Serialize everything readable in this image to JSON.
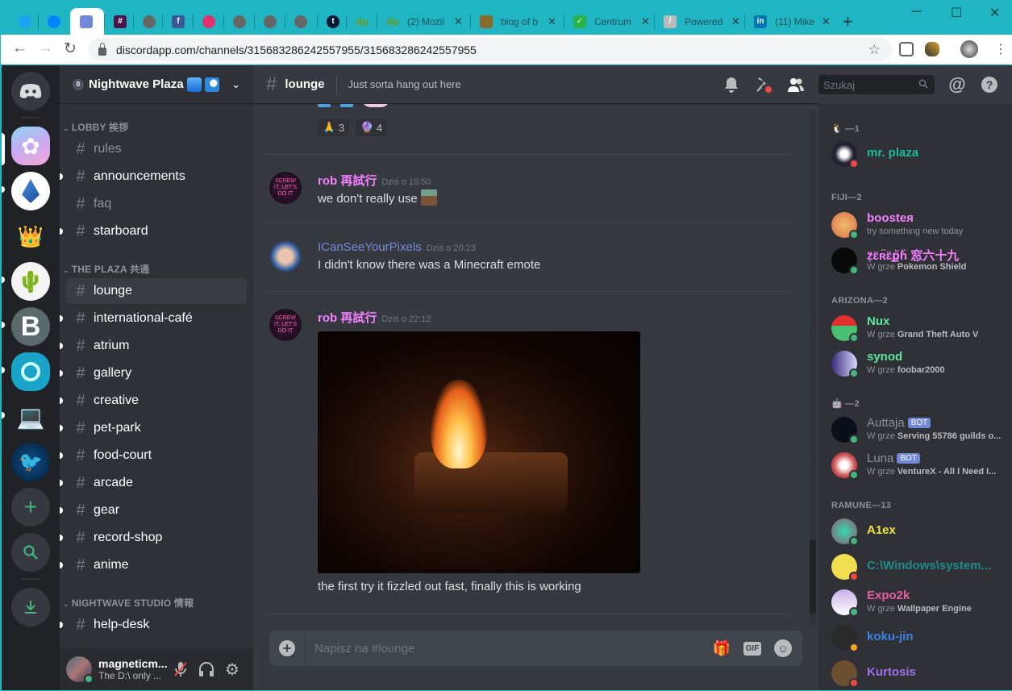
{
  "browser": {
    "tabs": [
      {
        "title": "",
        "favicon": "twitter-icon",
        "color": "#1da1f2"
      },
      {
        "title": "",
        "favicon": "messenger-icon",
        "color": "#0084ff"
      },
      {
        "title": "",
        "favicon": "discord-icon",
        "color": "#7289da",
        "active": true
      },
      {
        "title": "",
        "favicon": "slack-icon",
        "color": "#4a154b"
      },
      {
        "title": "",
        "favicon": "globe-icon",
        "color": "#666"
      },
      {
        "title": "",
        "favicon": "facebook-icon",
        "color": "#3b5998"
      },
      {
        "title": "",
        "favicon": "instagram-icon",
        "color": "#e1306c"
      },
      {
        "title": "",
        "favicon": "globe-icon",
        "color": "#666"
      },
      {
        "title": "",
        "favicon": "globe-icon",
        "color": "#666"
      },
      {
        "title": "",
        "favicon": "globe-icon",
        "color": "#666"
      },
      {
        "title": "",
        "favicon": "tumblr-icon",
        "color": "#001935"
      },
      {
        "title": "",
        "favicon": "dp-icon",
        "color": "#6a9a1f"
      },
      {
        "title": "(2) Mozil",
        "favicon": "dp-icon",
        "color": "#6a9a1f"
      },
      {
        "title": "blog of b",
        "favicon": "avatar-icon",
        "color": "#8a6a2a"
      },
      {
        "title": "Centrum",
        "favicon": "checkbox-icon",
        "color": "#2bb34a"
      },
      {
        "title": "Powered",
        "favicon": "feather-icon",
        "color": "#bbb"
      },
      {
        "title": "(11) Mike",
        "favicon": "linkedin-icon",
        "color": "#0077b5"
      }
    ],
    "url": "discordapp.com/channels/315683286242557955/315683286242557955"
  },
  "server": {
    "name": "Nightwave Plaza",
    "categories": [
      {
        "name": "LOBBY 挨拶"
      },
      {
        "name": "THE PLAZA 共通"
      },
      {
        "name": "NIGHTWAVE STUDIO 情報"
      }
    ],
    "channels": [
      {
        "name": "rules",
        "state": "read"
      },
      {
        "name": "announcements",
        "state": "unread"
      },
      {
        "name": "faq",
        "state": "read"
      },
      {
        "name": "starboard",
        "state": "unread"
      },
      {
        "name": "lounge",
        "state": "active"
      },
      {
        "name": "international-café",
        "state": "unread"
      },
      {
        "name": "atrium",
        "state": "unread"
      },
      {
        "name": "gallery",
        "state": "unread"
      },
      {
        "name": "creative",
        "state": "unread"
      },
      {
        "name": "pet-park",
        "state": "unread"
      },
      {
        "name": "food-court",
        "state": "unread"
      },
      {
        "name": "arcade",
        "state": "unread"
      },
      {
        "name": "gear",
        "state": "unread"
      },
      {
        "name": "record-shop",
        "state": "unread"
      },
      {
        "name": "anime",
        "state": "unread"
      },
      {
        "name": "help-desk",
        "state": "unread"
      }
    ]
  },
  "user": {
    "name": "magneticm...",
    "status": "The D:\\ only ..."
  },
  "chat": {
    "channel": "lounge",
    "topic": "Just sorta hang out here",
    "reactions": [
      {
        "emoji": "🙏",
        "count": "3"
      },
      {
        "emoji": "🔮",
        "count": "4"
      }
    ],
    "messages": [
      {
        "author": "rob 再試行",
        "color": "#f47fff",
        "time": "Dziś o 19:50",
        "text": "we don't really use"
      },
      {
        "author": "ICanSeeYourPixels",
        "color": "#7289da",
        "time": "Dziś o 20:23",
        "text": "I didn't know there was a Minecraft emote"
      },
      {
        "author": "rob 再試行",
        "color": "#f47fff",
        "time": "Dziś o 22:12",
        "text": "the first try it fizzled out fast, finally this is working"
      }
    ],
    "composer_placeholder": "Napisz na #lounge"
  },
  "header": {
    "search_placeholder": "Szukaj"
  },
  "members": {
    "groups": [
      {
        "label": "—1"
      },
      {
        "label": "FIJI—2"
      },
      {
        "label": "ARIZONA—2"
      },
      {
        "label": "—2"
      },
      {
        "label": "RAMUNE—13"
      }
    ],
    "list": [
      {
        "name": "mr. plaza",
        "color": "#1abc9c",
        "activity": "",
        "status": "dnd"
      },
      {
        "name": "boosteя",
        "color": "#f47fff",
        "activity": "try something new today",
        "status": "online"
      },
      {
        "name": "ẓ̈ɛ̈ʀ̈ɛ̈ք̈ɦ̈ 窓六十九",
        "color": "#f47fff",
        "activity_prefix": "W grze",
        "activity": "Pokemon Shield",
        "status": "online"
      },
      {
        "name": "Nux",
        "color": "#5ee6a0",
        "activity_prefix": "W grze",
        "activity": "Grand Theft Auto V",
        "status": "online"
      },
      {
        "name": "synod",
        "color": "#5ee6a0",
        "activity_prefix": "W grze",
        "activity": "foobar2000",
        "status": "online"
      },
      {
        "name": "Auttaja",
        "color": "#8e9297",
        "bot": "BOT",
        "activity_prefix": "W grze",
        "activity": "Serving 55786 guilds o...",
        "status": "online"
      },
      {
        "name": "Luna",
        "color": "#8e9297",
        "bot": "BOT",
        "activity_prefix": "W grze",
        "activity": "VentureX - All I Need I...",
        "status": "online"
      },
      {
        "name": "A1ex",
        "color": "#f1e23e",
        "activity": "",
        "status": "online"
      },
      {
        "name": "C:\\Windows\\system...",
        "color": "#1f8b8b",
        "activity": "",
        "status": "dnd"
      },
      {
        "name": "Expo2k",
        "color": "#e55e9d",
        "activity_prefix": "W grze",
        "activity": "Wallpaper Engine",
        "status": "online"
      },
      {
        "name": "koku-jin",
        "color": "#3e82e5",
        "activity": "",
        "status": "idle"
      },
      {
        "name": "Kurtosis",
        "color": "#a070e8",
        "activity": "",
        "status": "dnd"
      }
    ]
  }
}
